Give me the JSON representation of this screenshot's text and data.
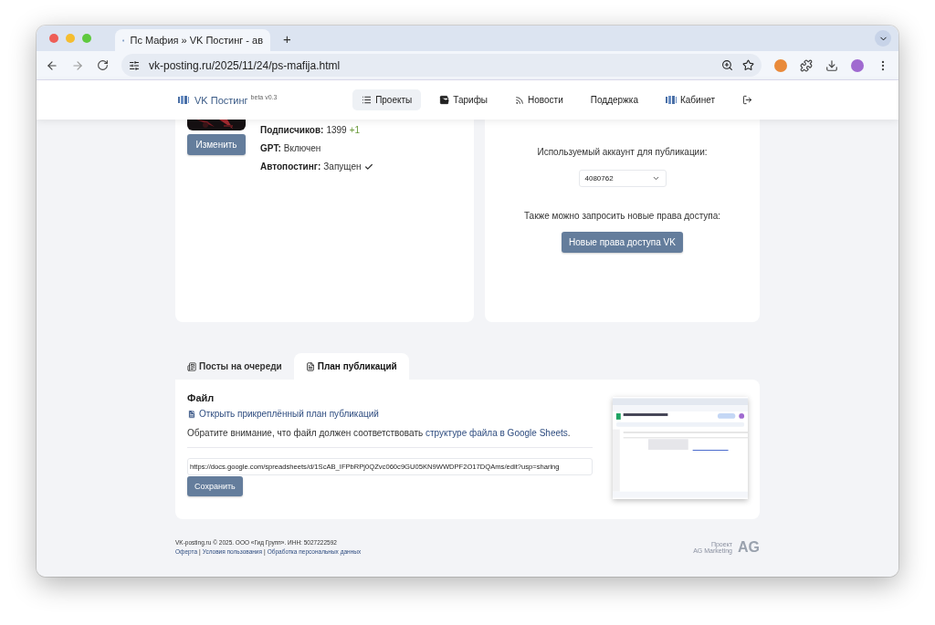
{
  "browser": {
    "tab_title": "Пс Мафия » VK Постинг - ав",
    "new_tab": "+",
    "url": "vk-posting.ru/2025/11/24/ps-mafija.html"
  },
  "nav": {
    "brand": "VK Постинг",
    "version": "beta v0.3",
    "items": [
      {
        "label": "Проекты",
        "selected": true
      },
      {
        "label": "Тарифы",
        "selected": false
      },
      {
        "label": "Новости",
        "selected": false
      },
      {
        "label": "Поддержка",
        "selected": false
      },
      {
        "label": "Кабинет",
        "selected": false
      }
    ]
  },
  "project": {
    "edit_button": "Изменить",
    "stats": [
      {
        "label": "Подписчиков:",
        "value": "1399",
        "delta": "+1"
      },
      {
        "label": "GPT:",
        "value": "Включен"
      },
      {
        "label": "Автопостинг:",
        "value": "Запущен",
        "checked": true
      }
    ]
  },
  "account": {
    "label": "Используемый аккаунт для публикации:",
    "selected_account": "4080762",
    "access_label": "Также можно запросить новые права доступа:",
    "access_button": "Новые права доступа VK"
  },
  "tabs": [
    {
      "label": "Посты на очереди",
      "selected": false
    },
    {
      "label": "План публикаций",
      "selected": true
    }
  ],
  "plan": {
    "heading": "Файл",
    "open_link": "Открыть прикреплённый план публикаций",
    "note_before": "Обратите внимание, что файл должен соответствовать ",
    "note_link": "структуре файла в Google Sheets",
    "note_after": ".",
    "url_value": "https://docs.google.com/spreadsheets/d/1ScAB_IFPbRPj0QZvc060c9GU05KN9WWDPF2O17DQAms/edit?usp=sharing",
    "save_button": "Сохранить"
  },
  "footer": {
    "copyright": "VK-posting.ru © 2025. ООО «Гид Групп». ИНН: 5027222592",
    "links": [
      "Оферта",
      "Условия пользования",
      "Обработка персональных данных"
    ],
    "separator": "|",
    "project_label": "Проект",
    "project_name": "AG Marketing",
    "logo": "AG"
  }
}
